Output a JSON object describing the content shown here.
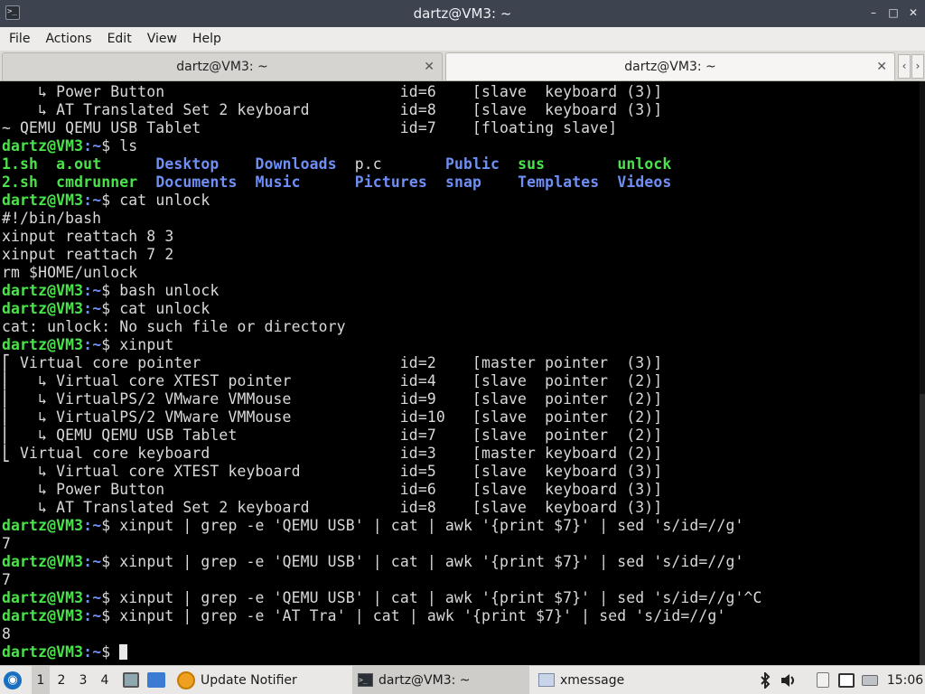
{
  "window": {
    "title": "dartz@VM3: ~",
    "app_icon": "terminal-icon",
    "controls": [
      "minimize-icon",
      "maximize-icon",
      "close-icon"
    ]
  },
  "menu": [
    "File",
    "Actions",
    "Edit",
    "View",
    "Help"
  ],
  "tabs": [
    {
      "label": "dartz@VM3: ~",
      "active": false
    },
    {
      "label": "dartz@VM3: ~",
      "active": true
    }
  ],
  "terminal": {
    "prompt_user": "dartz@VM3",
    "prompt_path": ":~",
    "prompt_sym": "$ ",
    "lines": [
      {
        "out": "    ↳ Power Button                          id=6    [slave  keyboard (3)]"
      },
      {
        "out": "    ↳ AT Translated Set 2 keyboard          id=8    [slave  keyboard (3)]"
      },
      {
        "out": "~ QEMU QEMU USB Tablet                      id=7    [floating slave]"
      },
      {
        "cmd": "ls"
      },
      {
        "files": [
          [
            "1.sh",
            "g"
          ],
          [
            "  ",
            "w"
          ],
          [
            "a.out",
            "g"
          ],
          [
            "      ",
            "w"
          ],
          [
            "Desktop",
            "b"
          ],
          [
            "    ",
            "w"
          ],
          [
            "Downloads",
            "b"
          ],
          [
            "  ",
            "w"
          ],
          [
            "p.c",
            "w"
          ],
          [
            "       ",
            "w"
          ],
          [
            "Public",
            "b"
          ],
          [
            "  ",
            "w"
          ],
          [
            "sus",
            "g"
          ],
          [
            "        ",
            "w"
          ],
          [
            "unlock",
            "g"
          ]
        ]
      },
      {
        "files": [
          [
            "2.sh",
            "g"
          ],
          [
            "  ",
            "w"
          ],
          [
            "cmdrunner",
            "g"
          ],
          [
            "  ",
            "w"
          ],
          [
            "Documents",
            "b"
          ],
          [
            "  ",
            "w"
          ],
          [
            "Music",
            "b"
          ],
          [
            "      ",
            "w"
          ],
          [
            "Pictures",
            "b"
          ],
          [
            "  ",
            "w"
          ],
          [
            "snap",
            "b"
          ],
          [
            "    ",
            "w"
          ],
          [
            "Templates",
            "b"
          ],
          [
            "  ",
            "w"
          ],
          [
            "Videos",
            "b"
          ]
        ]
      },
      {
        "cmd": "cat unlock"
      },
      {
        "out": "#!/bin/bash"
      },
      {
        "out": "xinput reattach 8 3"
      },
      {
        "out": "xinput reattach 7 2"
      },
      {
        "out": "rm $HOME/unlock"
      },
      {
        "cmd": "bash unlock"
      },
      {
        "cmd": "cat unlock"
      },
      {
        "out": "cat: unlock: No such file or directory"
      },
      {
        "cmd": "xinput"
      },
      {
        "out": "⎡ Virtual core pointer                      id=2    [master pointer  (3)]"
      },
      {
        "out": "⎜   ↳ Virtual core XTEST pointer            id=4    [slave  pointer  (2)]"
      },
      {
        "out": "⎜   ↳ VirtualPS/2 VMware VMMouse            id=9    [slave  pointer  (2)]"
      },
      {
        "out": "⎜   ↳ VirtualPS/2 VMware VMMouse            id=10   [slave  pointer  (2)]"
      },
      {
        "out": "⎜   ↳ QEMU QEMU USB Tablet                  id=7    [slave  pointer  (2)]"
      },
      {
        "out": "⎣ Virtual core keyboard                     id=3    [master keyboard (2)]"
      },
      {
        "out": "    ↳ Virtual core XTEST keyboard           id=5    [slave  keyboard (3)]"
      },
      {
        "out": "    ↳ Power Button                          id=6    [slave  keyboard (3)]"
      },
      {
        "out": "    ↳ AT Translated Set 2 keyboard          id=8    [slave  keyboard (3)]"
      },
      {
        "cmd": "xinput | grep -e 'QEMU USB' | cat | awk '{print $7}' | sed 's/id=//g'"
      },
      {
        "out": "7"
      },
      {
        "cmd": "xinput | grep -e 'QEMU USB' | cat | awk '{print $7}' | sed 's/id=//g'"
      },
      {
        "out": "7"
      },
      {
        "cmd": "xinput | grep -e 'QEMU USB' | cat | awk '{print $7}' | sed 's/id=//g'^C"
      },
      {
        "cmd": "xinput | grep -e 'AT Tra' | cat | awk '{print $7}' | sed 's/id=//g'"
      },
      {
        "out": "8"
      },
      {
        "cmd": "",
        "cursor": true
      }
    ]
  },
  "taskbar": {
    "start_icon": "lubuntu-logo-icon",
    "workspaces": [
      "1",
      "2",
      "3",
      "4"
    ],
    "active_workspace": "1",
    "quicklaunch": [
      "file-manager-icon",
      "show-desktop-icon"
    ],
    "tasks": [
      {
        "label": "Update Notifier",
        "icon": "update-notifier-icon",
        "active": false
      },
      {
        "label": "dartz@VM3: ~",
        "icon": "terminal-icon",
        "active": true
      },
      {
        "label": "xmessage",
        "icon": "window-icon",
        "active": false
      }
    ],
    "tray": [
      "bluetooth-icon",
      "volume-icon",
      "clipboard-icon",
      "network-icon",
      "removable-drive-icon"
    ],
    "clock": "15:06"
  },
  "colors": {
    "prompt_user": "#4be34b",
    "prompt_path": "#6f8ff5",
    "directory": "#6f8ff5",
    "executable": "#4be34b",
    "titlebar": "#3d4450"
  }
}
